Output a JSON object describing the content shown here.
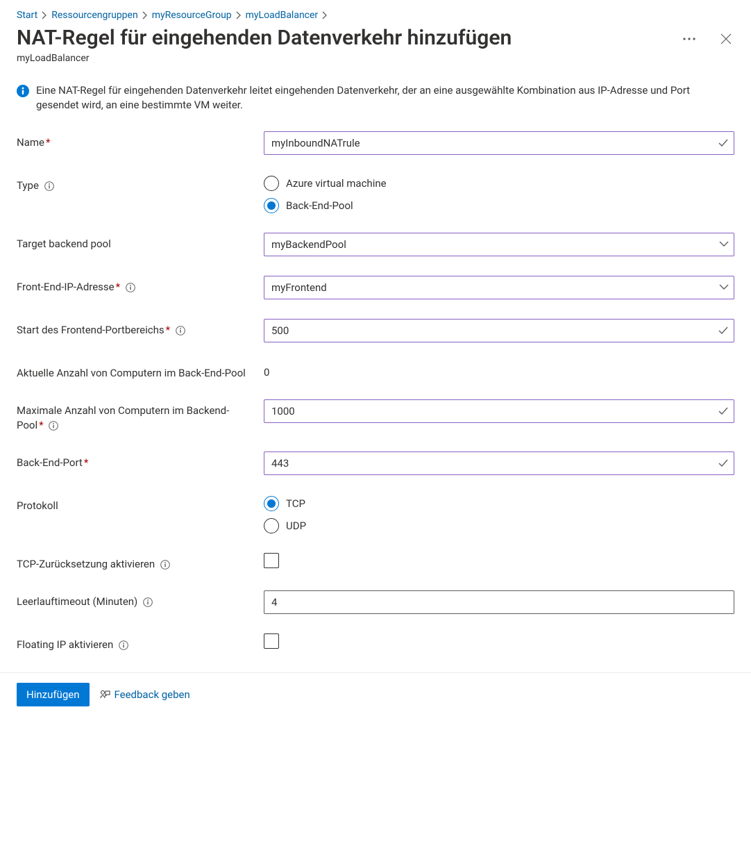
{
  "breadcrumb": {
    "items": [
      "Start",
      "Ressourcengruppen",
      "myResourceGroup",
      "myLoadBalancer"
    ]
  },
  "header": {
    "title": "NAT-Regel für eingehenden Datenverkehr hinzufügen",
    "subtitle": "myLoadBalancer"
  },
  "info": {
    "text": "Eine NAT-Regel für eingehenden Datenverkehr leitet eingehenden Datenverkehr, der an eine ausgewählte Kombination aus IP-Adresse und Port gesendet wird, an eine bestimmte VM weiter."
  },
  "form": {
    "name": {
      "label": "Name",
      "value": "myInboundNATrule"
    },
    "type": {
      "label": "Type",
      "options": [
        "Azure virtual machine",
        "Back-End-Pool"
      ],
      "selected": "Back-End-Pool"
    },
    "targetBackendPool": {
      "label": "Target backend pool",
      "value": "myBackendPool"
    },
    "frontendIp": {
      "label": "Front-End-IP-Adresse",
      "value": "myFrontend"
    },
    "frontendPortStart": {
      "label": "Start des Frontend-Portbereichs",
      "value": "500"
    },
    "currentMachines": {
      "label": "Aktuelle Anzahl von Computern im Back-End-Pool",
      "value": "0"
    },
    "maxMachines": {
      "label": "Maximale Anzahl von Computern im Backend-Pool",
      "value": "1000"
    },
    "backendPort": {
      "label": "Back-End-Port",
      "value": "443"
    },
    "protocol": {
      "label": "Protokoll",
      "options": [
        "TCP",
        "UDP"
      ],
      "selected": "TCP"
    },
    "tcpReset": {
      "label": "TCP-Zurücksetzung aktivieren",
      "checked": false
    },
    "idleTimeout": {
      "label": "Leerlauftimeout (Minuten)",
      "value": "4"
    },
    "floatingIp": {
      "label": "Floating IP aktivieren",
      "checked": false
    }
  },
  "footer": {
    "submit": "Hinzufügen",
    "feedback": "Feedback geben"
  }
}
